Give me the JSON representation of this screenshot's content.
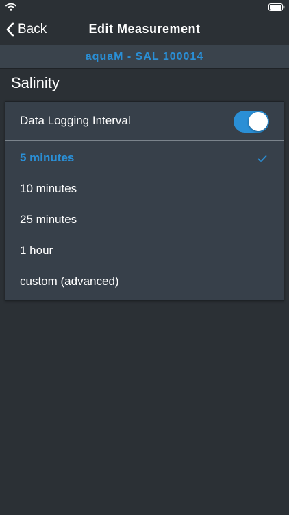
{
  "nav": {
    "back_label": "Back",
    "title": "Edit Measurement"
  },
  "device": {
    "name": "aquaM - SAL 100014"
  },
  "section": {
    "title": "Salinity"
  },
  "logging": {
    "label": "Data Logging Interval",
    "enabled": true
  },
  "options": [
    {
      "label": "5 minutes",
      "selected": true
    },
    {
      "label": "10 minutes",
      "selected": false
    },
    {
      "label": "25 minutes",
      "selected": false
    },
    {
      "label": "1 hour",
      "selected": false
    },
    {
      "label": "custom (advanced)",
      "selected": false
    }
  ],
  "icons": {
    "status_left": "wifi-icon",
    "status_right": "battery-icon",
    "back": "chevron-left-icon",
    "selected": "checkmark-icon"
  },
  "colors": {
    "accent": "#2a8fd6",
    "background": "#2b3035",
    "card": "#37404a",
    "banner": "#3a434c"
  }
}
